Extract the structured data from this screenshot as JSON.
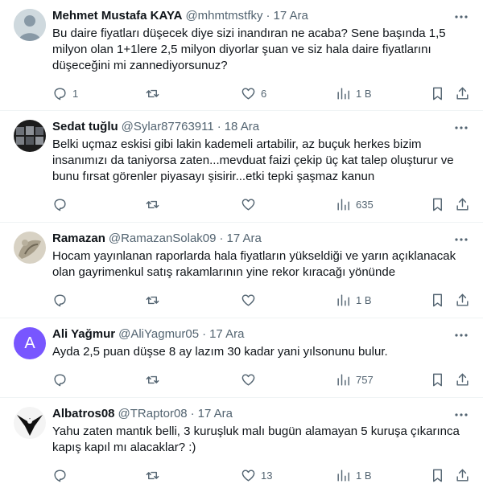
{
  "tweets": [
    {
      "name": "Mehmet Mustafa KAYA",
      "handle": "@mhmtmstfky",
      "time": "17 Ara",
      "text": "Bu daire fiyatları düşecek diye sizi inandıran ne acaba? Sene başında 1,5 milyon olan 1+1lere 2,5 milyon diyorlar şuan ve siz hala daire fiyatlarını düşeceğini mi zannediyorsunuz?",
      "replies": "1",
      "retweets": "",
      "likes": "6",
      "views": "1 B",
      "avatar": "default"
    },
    {
      "name": "Sedat tuğlu",
      "handle": "@Sylar87763911",
      "time": "18 Ara",
      "text": "Belki uçmaz eskisi gibi lakin kademeli artabilir, az buçuk herkes bizim insanımızı da taniyorsa zaten...mevduat faizi çekip üç kat talep oluşturur ve bunu fırsat görenler piyasayı şisirir...etki tepki şaşmaz kanun",
      "replies": "",
      "retweets": "",
      "likes": "",
      "views": "635",
      "avatar": "photo"
    },
    {
      "name": "Ramazan",
      "handle": "@RamazanSolak09",
      "time": "17 Ara",
      "text": "Hocam yayınlanan raporlarda hala fiyatların yükseldiği ve yarın açıklanacak olan gayrimenkul satış rakamlarının yine rekor kıracağı yönünde",
      "replies": "",
      "retweets": "",
      "likes": "",
      "views": "1 B",
      "avatar": "photo"
    },
    {
      "name": "Ali Yağmur",
      "handle": "@AliYagmur05",
      "time": "17 Ara",
      "text": "Ayda 2,5 puan düşse 8 ay lazım 30 kadar yani yılsonunu bulur.",
      "replies": "",
      "retweets": "",
      "likes": "",
      "views": "757",
      "avatar": "letter",
      "avatar_letter": "A"
    },
    {
      "name": "Albatros08",
      "handle": "@TRaptor08",
      "time": "17 Ara",
      "text": "Yahu zaten mantık belli, 3 kuruşluk malı bugün alamayan 5 kuruşa çıkarınca kapış kapıl mı alacaklar? :)",
      "replies": "",
      "retweets": "",
      "likes": "13",
      "views": "1 B",
      "avatar": "photo"
    }
  ],
  "colors": {
    "text": "#0f1419",
    "muted": "#536471",
    "border": "#eff3f4",
    "accent": "#7856ff"
  }
}
